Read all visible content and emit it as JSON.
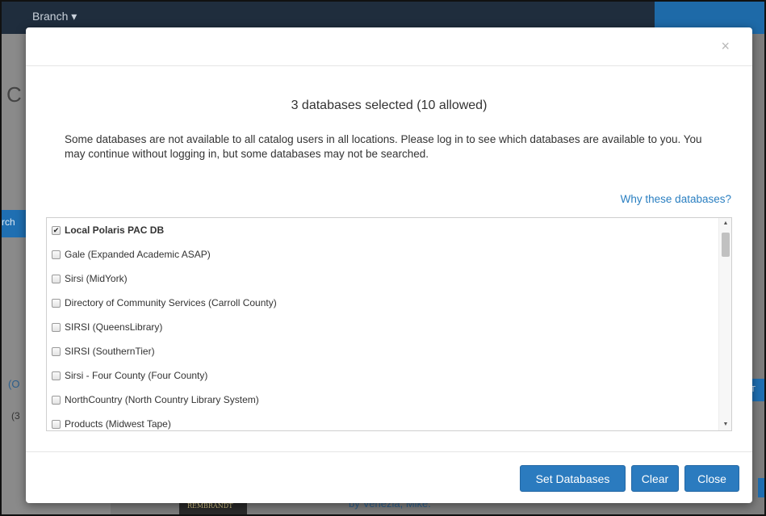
{
  "background": {
    "branch_label": "Branch",
    "title_fragment": "C",
    "tab_fragment": "rch",
    "link_fragment": "(O",
    "count_fragment": "(3",
    "right_button_fragment": "RT",
    "book_cover_text": "REMBRANDT",
    "author_line": "by Venezia, Mike."
  },
  "modal": {
    "close_symbol": "×",
    "title": "3 databases selected (10 allowed)",
    "note": "Some databases are not available to all catalog users in all locations. Please log in to see which databases are available to you. You may continue without logging in, but some databases may not be searched.",
    "why_link": "Why these databases?",
    "databases": [
      {
        "label": "Local Polaris PAC DB",
        "checked": true
      },
      {
        "label": "Gale (Expanded Academic ASAP)",
        "checked": false
      },
      {
        "label": "Sirsi (MidYork)",
        "checked": false
      },
      {
        "label": "Directory of Community Services (Carroll County)",
        "checked": false
      },
      {
        "label": "SIRSI (QueensLibrary)",
        "checked": false
      },
      {
        "label": "SIRSI (SouthernTier)",
        "checked": false
      },
      {
        "label": "Sirsi - Four County (Four County)",
        "checked": false
      },
      {
        "label": "NorthCountry (North Country Library System)",
        "checked": false
      },
      {
        "label": "Products (Midwest Tape)",
        "checked": false
      }
    ],
    "buttons": {
      "set": "Set Databases",
      "clear": "Clear",
      "close": "Close"
    }
  },
  "colors": {
    "primary_button": "#2b7bbf",
    "link": "#2a7fc1",
    "overlay": "#7d7d7d",
    "topbar": "#1f2d3d"
  }
}
